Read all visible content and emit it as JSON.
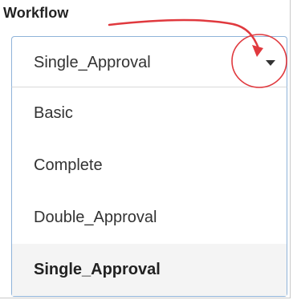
{
  "field": {
    "label": "Workflow"
  },
  "select": {
    "current_value": "Single_Approval",
    "caret_icon": "caret-down-icon",
    "expanded": true
  },
  "menu": {
    "options": [
      {
        "label": "Basic",
        "selected": false
      },
      {
        "label": "Complete",
        "selected": false
      },
      {
        "label": "Double_Approval",
        "selected": false
      },
      {
        "label": "Single_Approval",
        "selected": true
      }
    ]
  },
  "annotation": {
    "arrow_color": "#e0393e",
    "circle_color": "#e0393e"
  },
  "colors": {
    "border_accent": "#8fb3d9",
    "selected_background": "#f4f4f4",
    "text": "#333333"
  }
}
